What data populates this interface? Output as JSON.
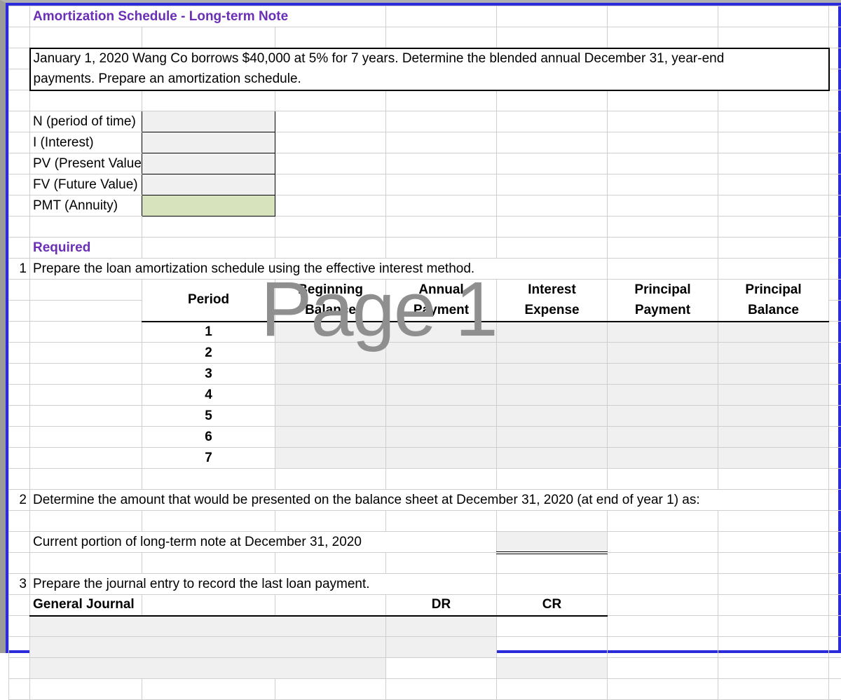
{
  "title": "Amortization Schedule - Long-term Note",
  "problem_line1": "January 1, 2020 Wang Co borrows $40,000 at 5% for 7 years. Determine the blended annual December 31, year-end",
  "problem_line2": "payments. Prepare an amortization schedule.",
  "inputs": {
    "n_label": "N (period of time)",
    "i_label": "I (Interest)",
    "pv_label": "PV (Present Value",
    "fv_label": "FV (Future Value)",
    "pmt_label": "PMT (Annuity)"
  },
  "required_label": "Required",
  "q1_num": "1",
  "q1_text": "Prepare the loan amortization schedule using the effective interest method.",
  "headers": {
    "period": "Period",
    "beg_bal1": "Beginning",
    "beg_bal2": "Balance",
    "ann_pay1": "Annual",
    "ann_pay2": "Payment",
    "int_exp1": "Interest",
    "int_exp2": "Expense",
    "prin_pay1": "Principal",
    "prin_pay2": "Payment",
    "prin_bal1": "Principal",
    "prin_bal2": "Balance"
  },
  "periods": [
    "1",
    "2",
    "3",
    "4",
    "5",
    "6",
    "7"
  ],
  "q2_num": "2",
  "q2_text": "Determine the amount that would be presented on the balance sheet at December 31, 2020 (at end of year 1) as:",
  "current_portion_label": "Current portion of long-term note at December 31, 2020",
  "q3_num": "3",
  "q3_text": "Prepare the journal entry to record the last loan payment.",
  "gj_label": "General Journal",
  "dr_label": "DR",
  "cr_label": "CR",
  "watermark": "Page 1"
}
